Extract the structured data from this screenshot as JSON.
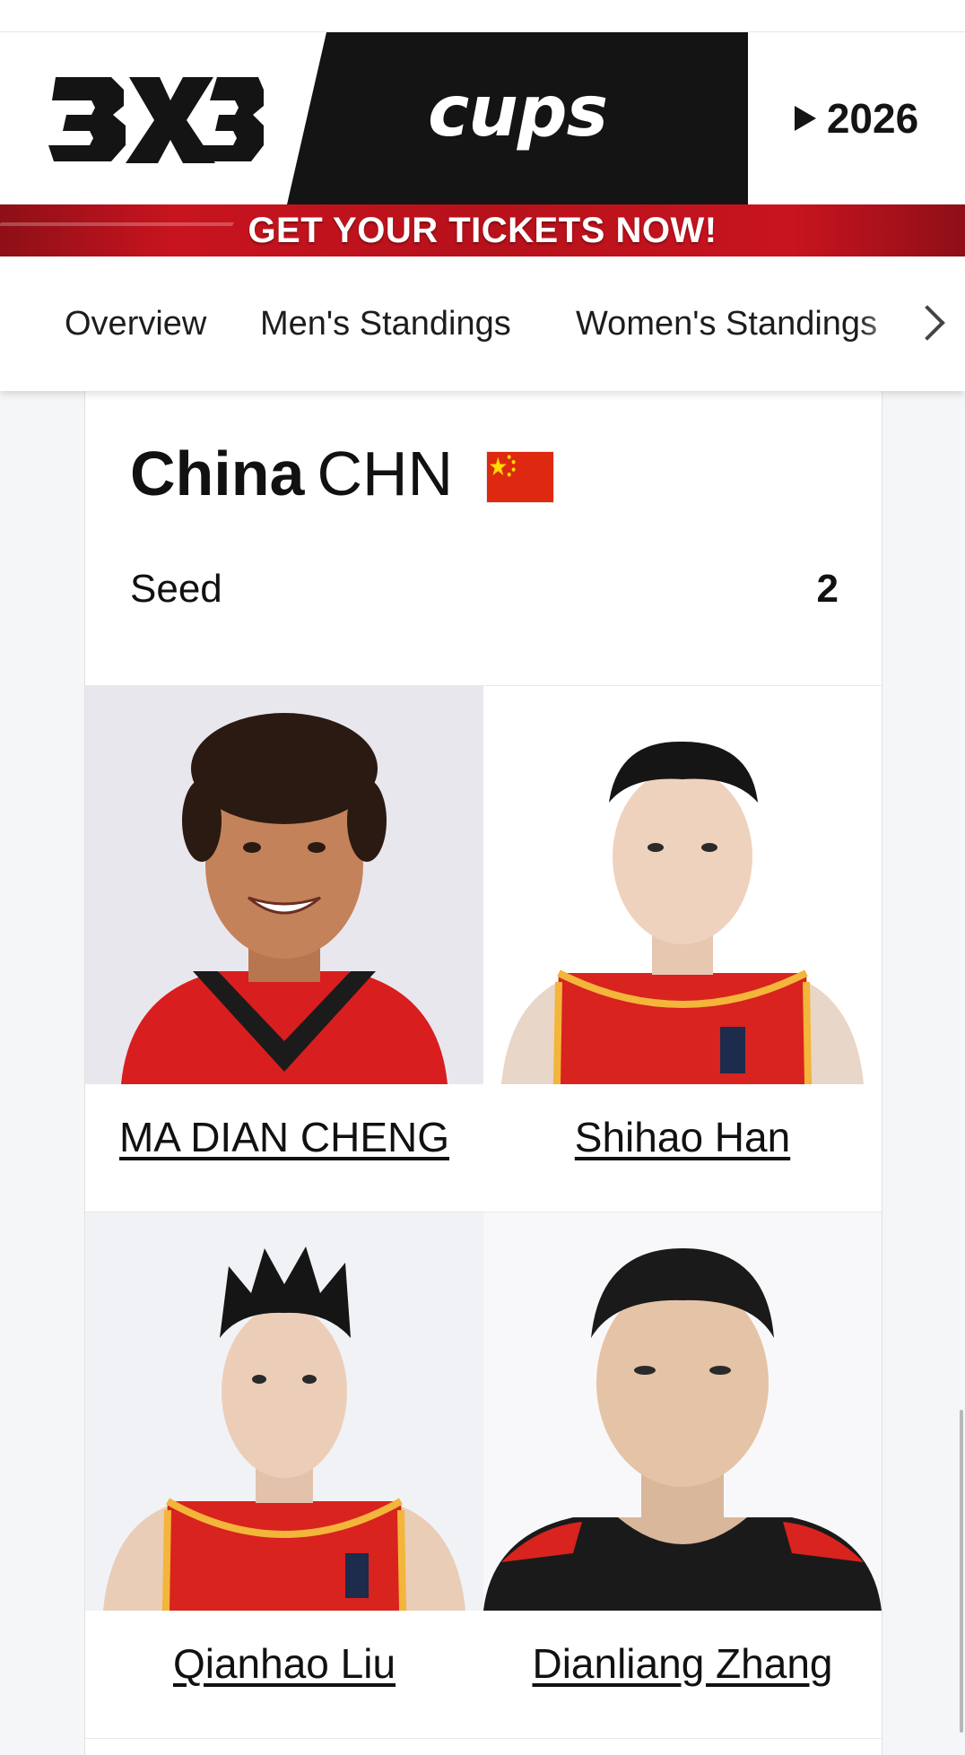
{
  "header": {
    "logo_text": "3X3",
    "brand_word": "cups",
    "year_label": "2026"
  },
  "banner": {
    "text": "GET YOUR TICKETS NOW!"
  },
  "tabs": [
    {
      "label": "Overview"
    },
    {
      "label": "Men's Standings"
    },
    {
      "label": "Women's Standings"
    }
  ],
  "team": {
    "name": "China",
    "code": "CHN",
    "seed_label": "Seed",
    "seed_value": "2"
  },
  "players": [
    {
      "name": "MA DIAN CHENG",
      "jersey": "black-red-v"
    },
    {
      "name": "Shihao Han",
      "jersey": "red-yellow"
    },
    {
      "name": "Qianhao Liu",
      "jersey": "red-yellow"
    },
    {
      "name": "Dianliang Zhang",
      "jersey": "black-red"
    }
  ],
  "colors": {
    "brand_red": "#c8141f",
    "brand_black": "#141414",
    "flag_red": "#de2910",
    "flag_star": "#ffde00"
  }
}
